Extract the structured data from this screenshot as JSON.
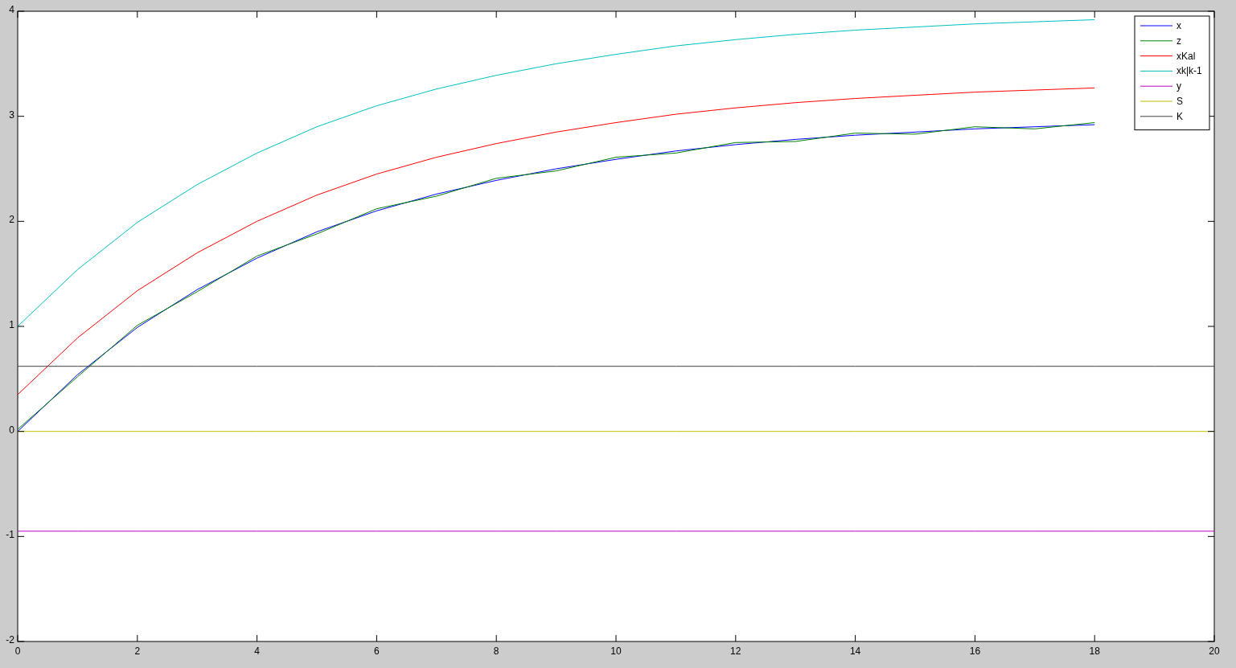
{
  "figure": {
    "chart_data": {
      "type": "line",
      "x": [
        0,
        1,
        2,
        3,
        4,
        5,
        6,
        7,
        8,
        9,
        10,
        11,
        12,
        13,
        14,
        15,
        16,
        17,
        18,
        19,
        20
      ],
      "xlim": [
        0,
        20
      ],
      "ylim": [
        -2,
        4
      ],
      "xticks": [
        0,
        2,
        4,
        6,
        8,
        10,
        12,
        14,
        16,
        18,
        20
      ],
      "yticks": [
        -2,
        -1,
        0,
        1,
        2,
        3,
        4
      ],
      "legend": "upper right",
      "series": [
        {
          "name": "x",
          "color": "#0000ff",
          "values": [
            0,
            0.54,
            0.99,
            1.35,
            1.65,
            1.9,
            2.1,
            2.26,
            2.39,
            2.5,
            2.59,
            2.67,
            2.73,
            2.78,
            2.82,
            2.85,
            2.88,
            2.9,
            2.92,
            null,
            null
          ]
        },
        {
          "name": "z",
          "color": "#008000",
          "values": [
            0.02,
            0.52,
            1.01,
            1.33,
            1.67,
            1.88,
            2.12,
            2.24,
            2.41,
            2.48,
            2.61,
            2.65,
            2.75,
            2.76,
            2.84,
            2.83,
            2.9,
            2.88,
            2.94,
            null,
            null
          ]
        },
        {
          "name": "xKal",
          "color": "#ff0000",
          "values": [
            0.35,
            0.89,
            1.34,
            1.7,
            2.0,
            2.25,
            2.45,
            2.61,
            2.74,
            2.85,
            2.94,
            3.02,
            3.08,
            3.13,
            3.17,
            3.2,
            3.23,
            3.25,
            3.27,
            null,
            null
          ]
        },
        {
          "name": "xk|k-1",
          "color": "#00bfbf",
          "values": [
            1.0,
            1.54,
            1.99,
            2.35,
            2.65,
            2.9,
            3.1,
            3.26,
            3.39,
            3.5,
            3.59,
            3.67,
            3.73,
            3.78,
            3.82,
            3.85,
            3.88,
            3.9,
            3.92,
            null,
            null
          ]
        },
        {
          "name": "y",
          "color": "#bf00bf",
          "values": [
            -0.95,
            -0.95,
            -0.95,
            -0.95,
            -0.95,
            -0.95,
            -0.95,
            -0.95,
            -0.95,
            -0.95,
            -0.95,
            -0.95,
            -0.95,
            -0.95,
            -0.95,
            -0.95,
            -0.95,
            -0.95,
            -0.95,
            -0.95,
            -0.95
          ]
        },
        {
          "name": "S",
          "color": "#bfbf00",
          "values": [
            0,
            0,
            0,
            0,
            0,
            0,
            0,
            0,
            0,
            0,
            0,
            0,
            0,
            0,
            0,
            0,
            0,
            0,
            0,
            0,
            0
          ]
        },
        {
          "name": "K",
          "color": "#404040",
          "values": [
            0.62,
            0.62,
            0.62,
            0.62,
            0.62,
            0.62,
            0.62,
            0.62,
            0.62,
            0.62,
            0.62,
            0.62,
            0.62,
            0.62,
            0.62,
            0.62,
            0.62,
            0.62,
            0.62,
            0.62,
            0.62
          ]
        }
      ]
    }
  }
}
